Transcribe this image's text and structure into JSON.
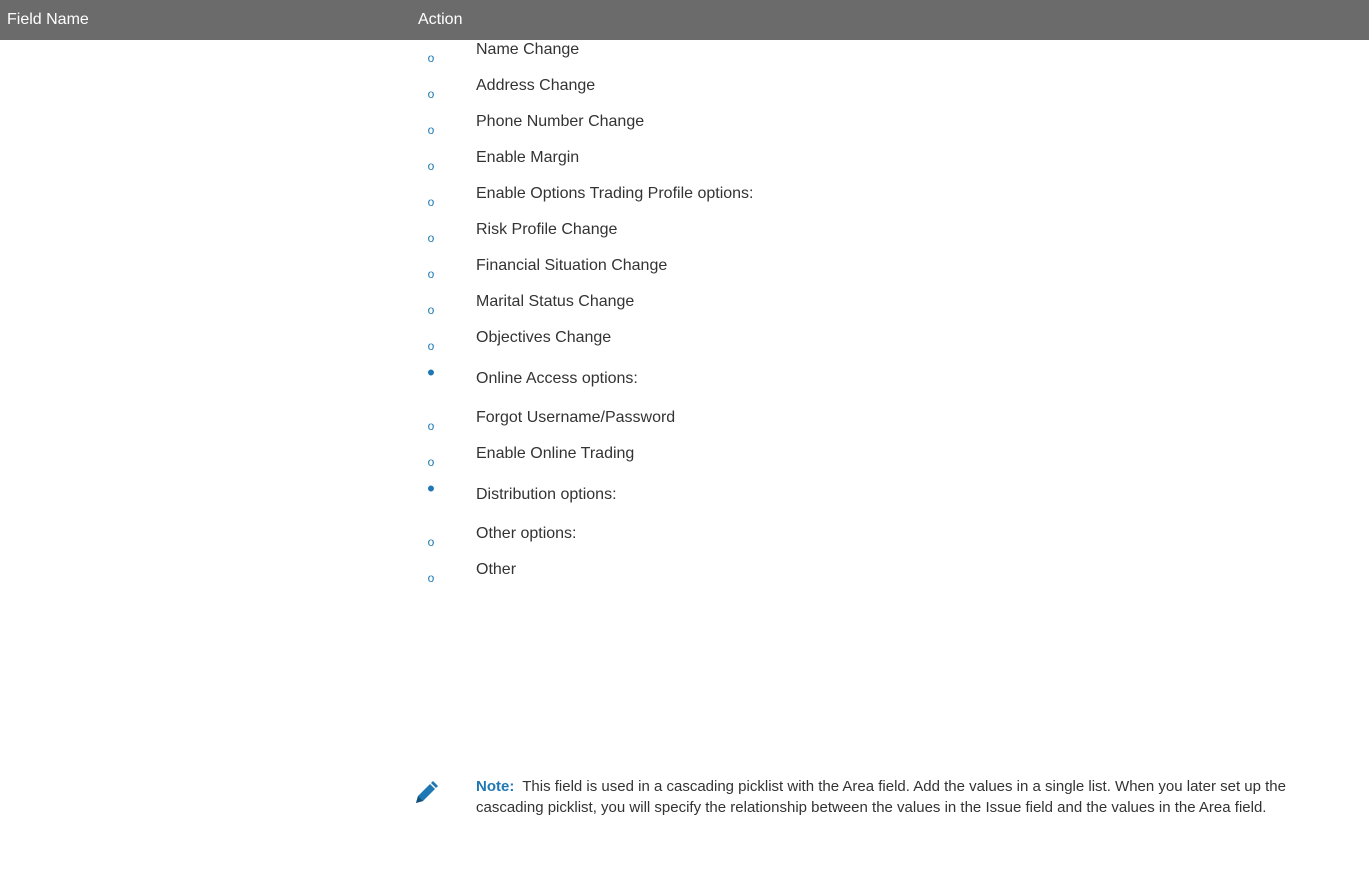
{
  "table": {
    "headers": {
      "field_name": "Field Name",
      "action": "Action"
    }
  },
  "action_items": [
    {
      "type": "sub",
      "marker": "o",
      "text": "Name Change"
    },
    {
      "type": "sub",
      "marker": "o",
      "text": "Address Change"
    },
    {
      "type": "sub",
      "marker": "o",
      "text": "Phone Number Change"
    },
    {
      "type": "sub",
      "marker": "o",
      "text": "Enable Margin"
    },
    {
      "type": "sub",
      "marker": "o",
      "text": "Enable Options Trading Profile options:"
    },
    {
      "type": "sub",
      "marker": "o",
      "text": "Risk Profile Change"
    },
    {
      "type": "sub",
      "marker": "o",
      "text": "Financial Situation Change"
    },
    {
      "type": "sub",
      "marker": "o",
      "text": "Marital Status Change"
    },
    {
      "type": "sub",
      "marker": "o",
      "text": "Objectives Change"
    },
    {
      "type": "bullet",
      "marker": "•",
      "text": "Online Access options:"
    },
    {
      "type": "sub",
      "marker": "o",
      "text": "Forgot Username/Password"
    },
    {
      "type": "sub",
      "marker": "o",
      "text": "Enable Online Trading"
    },
    {
      "type": "bullet",
      "marker": "•",
      "text": "Distribution options:"
    },
    {
      "type": "sub",
      "marker": "o",
      "text": "Other options:"
    },
    {
      "type": "sub",
      "marker": "o",
      "text": "Other"
    }
  ],
  "note": {
    "icon": "pencil-icon",
    "label": "Note:",
    "text": "This field is used in a cascading picklist with the Area field. Add the values in a single list. When you later set up the cascading picklist, you will specify the relationship between the values in the Issue field and the values in the Area field.",
    "accent_color": "#1f78b4"
  },
  "colors": {
    "header_bg": "#6b6b6b",
    "header_text": "#ffffff",
    "marker": "#1f78b4",
    "body_text": "#333333"
  }
}
